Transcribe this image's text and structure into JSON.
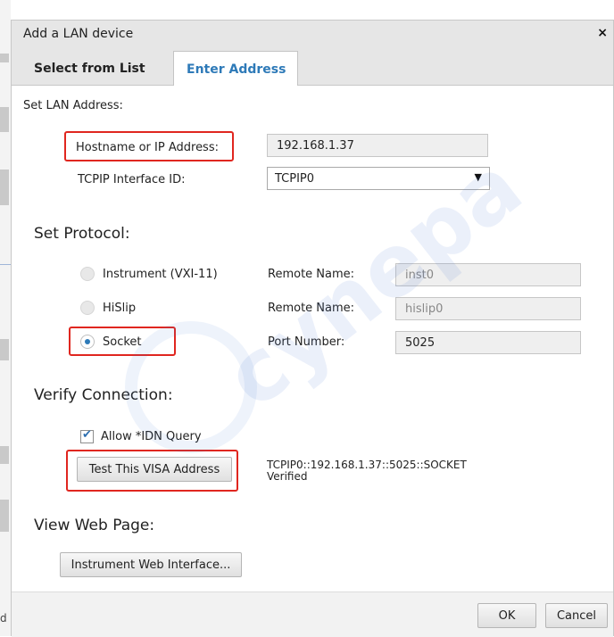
{
  "background": {
    "partial_letter": "d"
  },
  "dialog": {
    "title": "Add a LAN device",
    "close_glyph": "×",
    "tabs": [
      {
        "label": "Select from List",
        "selected": false
      },
      {
        "label": "Enter Address",
        "selected": true
      }
    ]
  },
  "lan": {
    "heading": "Set LAN Address:",
    "hostname_label": "Hostname or IP Address:",
    "hostname_value": "192.168.1.37",
    "interface_label": "TCPIP Interface ID:",
    "interface_value": "TCPIP0"
  },
  "protocol": {
    "heading": "Set Protocol:",
    "options": [
      {
        "label": "Instrument (VXI-11)",
        "field_label": "Remote Name:",
        "field_value": "inst0",
        "selected": false
      },
      {
        "label": "HiSlip",
        "field_label": "Remote Name:",
        "field_value": "hislip0",
        "selected": false
      },
      {
        "label": "Socket",
        "field_label": "Port Number:",
        "field_value": "5025",
        "selected": true
      }
    ]
  },
  "verify": {
    "heading": "Verify Connection:",
    "allow_idn_label": "Allow *IDN Query",
    "allow_idn_checked": true,
    "test_button": "Test This VISA Address",
    "result_address": "TCPIP0::192.168.1.37::5025::SOCKET",
    "result_status": "Verified"
  },
  "web": {
    "heading": "View Web Page:",
    "button": "Instrument Web Interface..."
  },
  "footer": {
    "ok": "OK",
    "cancel": "Cancel"
  },
  "colors": {
    "accent": "#2e7ab8",
    "highlight": "#e0261f"
  }
}
